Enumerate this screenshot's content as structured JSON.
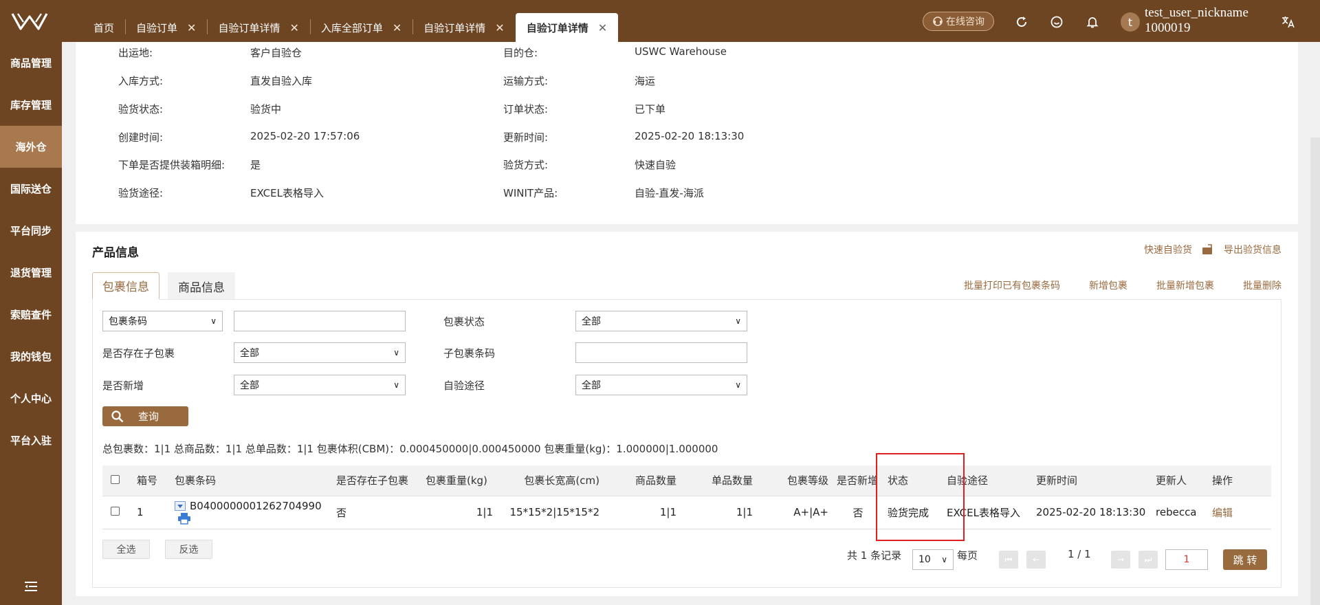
{
  "tabs": [
    {
      "label": "首页",
      "closable": false
    },
    {
      "label": "自验订单",
      "closable": true
    },
    {
      "label": "自验订单详情",
      "closable": true
    },
    {
      "label": "入库全部订单",
      "closable": true
    },
    {
      "label": "自验订单详情",
      "closable": true
    },
    {
      "label": "自验订单详情",
      "closable": true,
      "active": true
    }
  ],
  "header": {
    "consult_label": "在线咨询",
    "user_name": "test_user_nickname",
    "user_id": "1000019",
    "avatar_letter": "t",
    "accent_color": "#6e4523"
  },
  "sidebar": {
    "items": [
      {
        "label": "商品管理"
      },
      {
        "label": "库存管理"
      },
      {
        "label": "海外仓",
        "active": true
      },
      {
        "label": "国际送仓"
      },
      {
        "label": "平台同步"
      },
      {
        "label": "退货管理"
      },
      {
        "label": "索赔查件"
      },
      {
        "label": "我的钱包"
      },
      {
        "label": "个人中心"
      },
      {
        "label": "平台入驻"
      }
    ]
  },
  "info": {
    "origin_label": "出运地:",
    "origin_value": "客户自验仓",
    "dest_label": "目的仓:",
    "dest_value": "USWC Warehouse",
    "inbound_label": "入库方式:",
    "inbound_value": "直发自验入库",
    "transport_label": "运输方式:",
    "transport_value": "海运",
    "inspect_status_label": "验货状态:",
    "inspect_status_value": "验货中",
    "order_status_label": "订单状态:",
    "order_status_value": "已下单",
    "created_label": "创建时间:",
    "created_value": "2025-02-20 17:57:06",
    "updated_label": "更新时间:",
    "updated_value": "2025-02-20 18:13:30",
    "box_detail_label": "下单是否提供装箱明细:",
    "box_detail_value": "是",
    "inspect_method_label": "验货方式:",
    "inspect_method_value": "快速自验",
    "inspect_path_label": "验货途径:",
    "inspect_path_value": "EXCEL表格导入",
    "winit_label": "WINIT产品:",
    "winit_value": "自验-直发-海派"
  },
  "product": {
    "title": "产品信息",
    "quick_inspect": "快速自验货",
    "export_label": "导出验货信息",
    "subtabs": [
      "包裹信息",
      "商品信息"
    ],
    "batch_print": "批量打印已有包裹条码",
    "add_package": "新增包裹",
    "batch_add": "批量新增包裹",
    "batch_delete": "批量删除"
  },
  "filters": {
    "barcode_select": "包裹条码",
    "package_status_label": "包裹状态",
    "package_status_value": "全部",
    "has_child_label": "是否存在子包裹",
    "has_child_value": "全部",
    "child_barcode_label": "子包裹条码",
    "is_new_label": "是否新增",
    "is_new_value": "全部",
    "self_path_label": "自验途径",
    "self_path_value": "全部",
    "query_label": "查询"
  },
  "summary": {
    "text": "总包裹数：1|1    总商品数：1|1    总单品数：1|1    包裹体积(CBM)：0.000450000|0.000450000    包裹重量(kg)：1.000000|1.000000"
  },
  "table": {
    "headers": [
      "箱号",
      "包裹条码",
      "是否存在子包裹",
      "包裹重量(kg)",
      "包裹长宽高(cm)",
      "商品数量",
      "单品数量",
      "包裹等级",
      "是否新增",
      "状态",
      "自验途径",
      "更新时间",
      "更新人",
      "操作"
    ],
    "rows": [
      {
        "box_no": "1",
        "barcode": "B0400000001262704990",
        "has_child": "否",
        "weight": "1|1",
        "dims": "15*15*2|15*15*2",
        "item_qty": "1|1",
        "unit_qty": "1|1",
        "grade": "A+|A+",
        "is_new": "否",
        "status": "验货完成",
        "path": "EXCEL表格导入",
        "updated": "2025-02-20 18:13:30",
        "updater": "rebecca",
        "action": "编辑"
      }
    ]
  },
  "footer": {
    "select_all": "全选",
    "invert": "反选",
    "total_text": "共 1 条记录",
    "page_size": "10",
    "per_page": "每页",
    "page_info": "1 / 1",
    "page_input": "1",
    "jump_label": "跳 转"
  }
}
